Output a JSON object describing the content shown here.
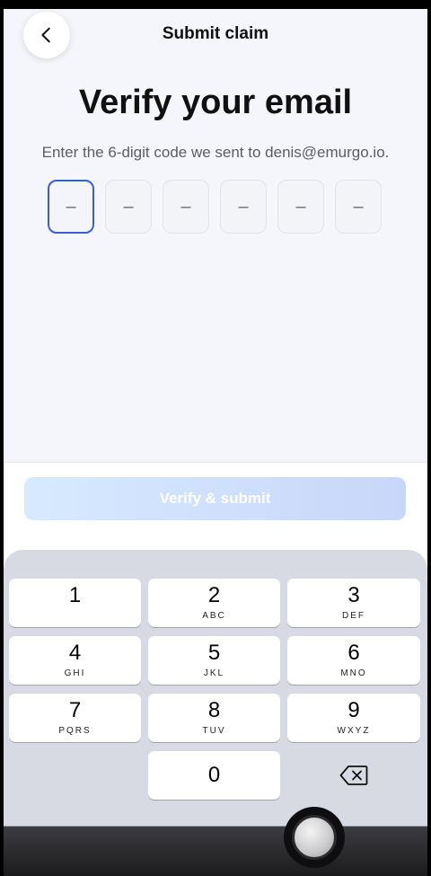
{
  "header": {
    "title": "Submit claim",
    "back_icon": "chevron-left-icon"
  },
  "main": {
    "title": "Verify your email",
    "subtitle": "Enter the 6-digit code we sent to denis@emurgo.io.",
    "code_placeholder": "–",
    "code_length": 6
  },
  "actions": {
    "verify_label": "Verify & submit",
    "verify_enabled": false
  },
  "keyboard": {
    "keys": [
      {
        "digit": "1",
        "letters": ""
      },
      {
        "digit": "2",
        "letters": "ABC"
      },
      {
        "digit": "3",
        "letters": "DEF"
      },
      {
        "digit": "4",
        "letters": "GHI"
      },
      {
        "digit": "5",
        "letters": "JKL"
      },
      {
        "digit": "6",
        "letters": "MNO"
      },
      {
        "digit": "7",
        "letters": "PQRS"
      },
      {
        "digit": "8",
        "letters": "TUV"
      },
      {
        "digit": "9",
        "letters": "WXYZ"
      },
      {
        "digit": "0",
        "letters": ""
      }
    ],
    "delete_icon": "backspace-icon"
  },
  "colors": {
    "accent": "#3a5fcb",
    "button_gradient_start": "#d7eaff",
    "button_gradient_end": "#c8d6f9"
  }
}
